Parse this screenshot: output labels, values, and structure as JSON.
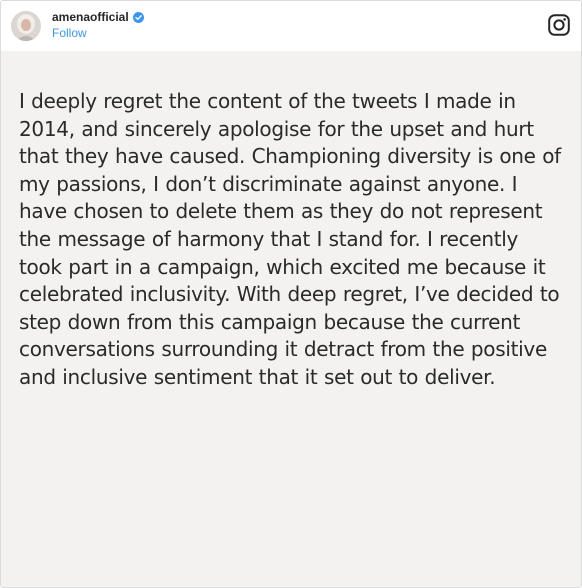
{
  "post": {
    "username": "amenaofficial",
    "follow_label": "Follow",
    "verified": true,
    "accent_color": "#3897f0",
    "logo_icon": "instagram-icon",
    "text": "I deeply regret the content of the tweets I made in 2014, and sincerely apologise for the upset and hurt that they have caused. Championing diversity is one of my passions, I don’t discriminate against anyone. I have chosen to delete them as they do not represent the message of harmony that I stand for. I recently took part in a campaign, which excited me because it celebrated inclusivity. With deep regret, I’ve decided to step down from this campaign because the current conversations surrounding it detract from the positive and inclusive sentiment that it set out to deliver."
  }
}
